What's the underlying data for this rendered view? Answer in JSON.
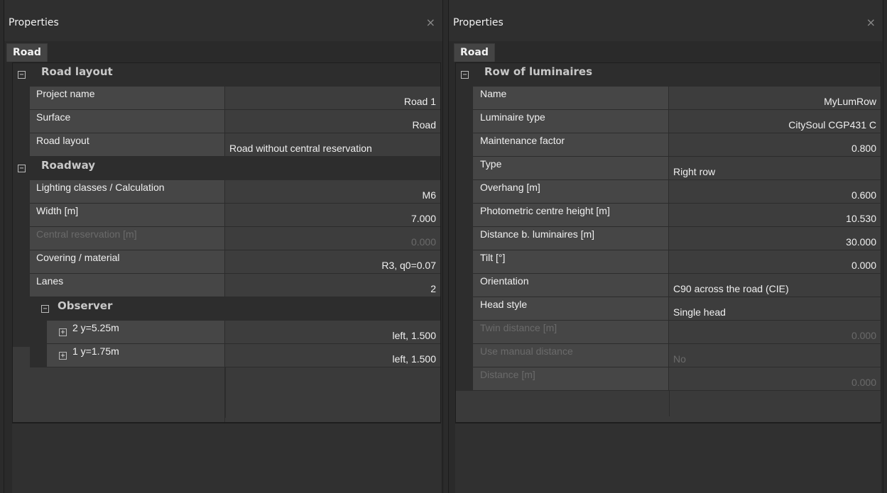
{
  "left": {
    "title": "Properties",
    "close_glyph": "×",
    "tab": "Road",
    "categories": {
      "road_layout": "Road layout",
      "roadway": "Roadway",
      "observer": "Observer"
    },
    "rows": {
      "project_name": {
        "name": "Project name",
        "value": "Road 1"
      },
      "surface": {
        "name": "Surface",
        "value": "Road"
      },
      "road_layout": {
        "name": "Road layout",
        "value": "Road without central reservation"
      },
      "lighting_classes": {
        "name": "Lighting classes / Calculation",
        "value": "M6"
      },
      "width": {
        "name": "Width [m]",
        "value": "7.000"
      },
      "central_reservation": {
        "name": "Central reservation [m]",
        "value": "0.000"
      },
      "covering": {
        "name": "Covering / material",
        "value": "R3, q0=0.07"
      },
      "lanes": {
        "name": "Lanes",
        "value": "2"
      },
      "observer_2": {
        "name": "2 y=5.25m",
        "value": "left, 1.500"
      },
      "observer_1": {
        "name": "1 y=1.75m",
        "value": "left, 1.500"
      }
    }
  },
  "right": {
    "title": "Properties",
    "close_glyph": "×",
    "tab": "Road",
    "categories": {
      "row_of_luminaires": "Row of luminaires"
    },
    "rows": {
      "name": {
        "name": "Name",
        "value": "MyLumRow"
      },
      "luminaire_type": {
        "name": "Luminaire type",
        "value": "CitySoul CGP431 C"
      },
      "maintenance_factor": {
        "name": "Maintenance factor",
        "value": "0.800"
      },
      "type": {
        "name": "Type",
        "value": "Right row"
      },
      "overhang": {
        "name": "Overhang [m]",
        "value": "0.600"
      },
      "photometric_height": {
        "name": "Photometric centre height [m]",
        "value": "10.530"
      },
      "distance_luminaires": {
        "name": "Distance b. luminaires [m]",
        "value": "30.000"
      },
      "tilt": {
        "name": "Tilt [°]",
        "value": "0.000"
      },
      "orientation": {
        "name": "Orientation",
        "value": "C90 across the road (CIE)"
      },
      "head_style": {
        "name": "Head style",
        "value": "Single head"
      },
      "twin_distance": {
        "name": "Twin distance [m]",
        "value": "0.000"
      },
      "use_manual_distance": {
        "name": "Use manual distance",
        "value": "No"
      },
      "distance": {
        "name": "Distance [m]",
        "value": "0.000"
      }
    }
  },
  "glyphs": {
    "collapse": "−",
    "expand": "+"
  }
}
